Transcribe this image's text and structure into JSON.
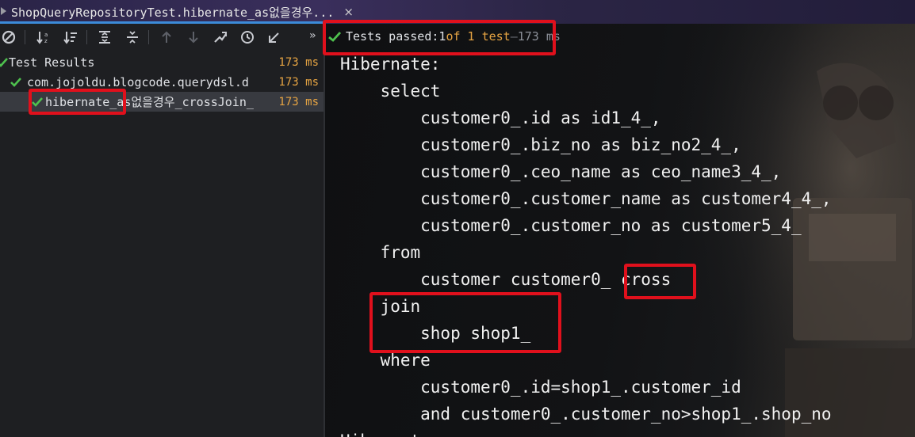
{
  "tab": {
    "title": "ShopQueryRepositoryTest.hibernate_as없을경우...",
    "close": "×"
  },
  "toolbar": {
    "more": "»"
  },
  "tree": {
    "root": {
      "label": "Test Results",
      "time": "173 ms"
    },
    "suite": {
      "label": "com.jojoldu.blogcode.querydsl.d",
      "time": "173 ms"
    },
    "test": {
      "label": "hibernate_as없을경우_crossJoin_",
      "time": "173 ms"
    }
  },
  "status": {
    "passed": "Tests passed: ",
    "count": "1",
    "of": " of 1 test",
    "dash": " – ",
    "duration": "173 ms"
  },
  "console": {
    "lines": [
      "Hibernate:",
      "    select",
      "        customer0_.id as id1_4_,",
      "        customer0_.biz_no as biz_no2_4_,",
      "        customer0_.ceo_name as ceo_name3_4_,",
      "        customer0_.customer_name as customer4_4_,",
      "        customer0_.customer_no as customer5_4_",
      "    from",
      "        customer customer0_ cross",
      "    join",
      "        shop shop1_",
      "    where",
      "        customer0_.id=shop1_.customer_id",
      "        and customer0_.customer_no>shop1_.shop_no",
      "Hibernate:"
    ]
  },
  "colors": {
    "accent": "#3c8bd9",
    "pass": "#4ec14e",
    "time": "#e6a443",
    "highlight": "#e0101c"
  }
}
